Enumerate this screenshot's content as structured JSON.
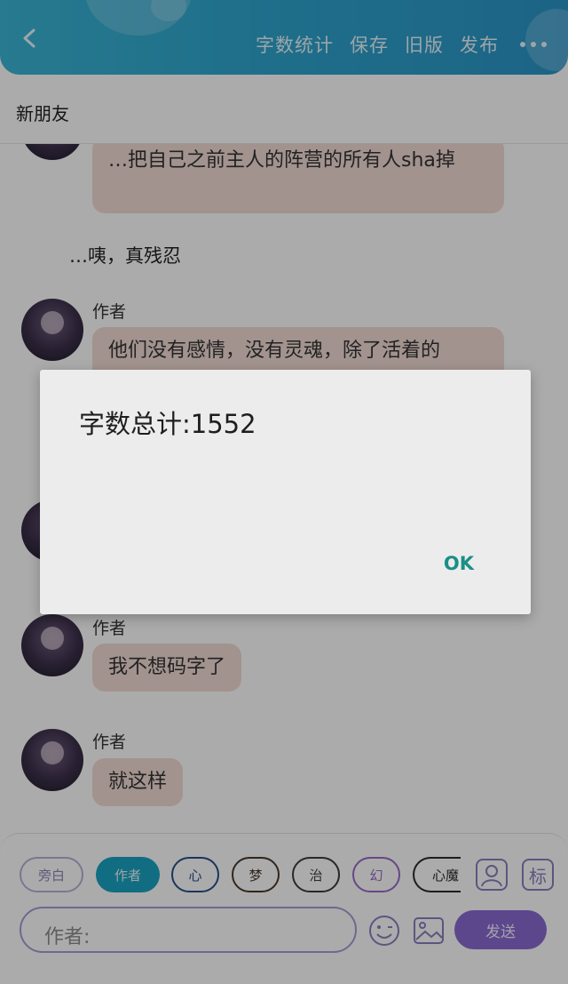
{
  "topbar": {
    "actions": [
      "字数统计",
      "保存",
      "旧版",
      "发布"
    ]
  },
  "subheader": {
    "title": "新朋友"
  },
  "messages": {
    "m1_text": "…把自己之前主人的阵营的所有人sha掉",
    "narration": "…咦，真残忍",
    "m2_name": "作者",
    "m2_text": "他们没有感情，没有灵魂，除了活着的",
    "m3_name": "作者",
    "m3_text": "我不想码字了",
    "m4_name": "作者",
    "m4_text": "就这样"
  },
  "composer": {
    "roles": [
      "旁白",
      "作者",
      "心",
      "梦",
      "治",
      "幻",
      "心魔"
    ],
    "active_role": "作者",
    "role_btn_label": "标",
    "input_value": "作者:",
    "send_label": "发送",
    "colors": {
      "active_role": "#1aa3c2",
      "send": "#8a6ad2"
    }
  },
  "dialog": {
    "message": "字数总计:1552",
    "ok_label": "OK"
  }
}
